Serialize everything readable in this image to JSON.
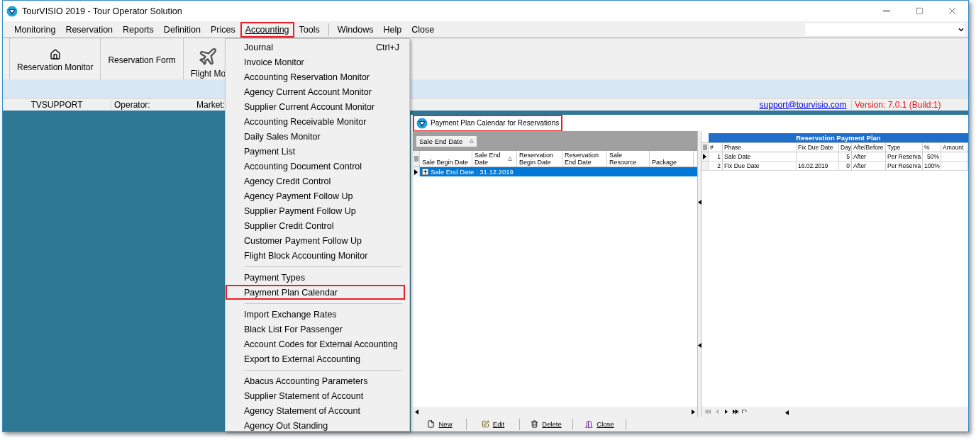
{
  "window": {
    "title": "TourVISIO 2019 - Tour Operator Solution"
  },
  "menubar": [
    {
      "label": "Monitoring",
      "selected": false
    },
    {
      "label": "Reservation",
      "selected": false
    },
    {
      "label": "Reports",
      "selected": false
    },
    {
      "label": "Definition",
      "selected": false
    },
    {
      "label": "Prices",
      "selected": false
    },
    {
      "label": "Accounting",
      "selected": true
    },
    {
      "label": "Tools",
      "selected": false
    },
    {
      "label": "Windows",
      "selected": false
    },
    {
      "label": "Help",
      "selected": false
    },
    {
      "label": "Close",
      "selected": false
    }
  ],
  "toolbar": [
    {
      "label": "Reservation Monitor"
    },
    {
      "label": "Reservation Form"
    },
    {
      "label": "Flight Mo"
    }
  ],
  "status_bar": {
    "user": "TVSUPPORT",
    "operator": "Operator:",
    "market": "Market:",
    "email": "support@tourvisio.com",
    "version": "Version: 7.0.1 (Build:1)"
  },
  "accounting_menu": [
    {
      "kind": "item",
      "label": "Journal",
      "shortcut": "Ctrl+J",
      "highlighted": false
    },
    {
      "kind": "item",
      "label": "Invoice Monitor",
      "highlighted": false
    },
    {
      "kind": "item",
      "label": "Accounting Reservation Monitor",
      "highlighted": false
    },
    {
      "kind": "item",
      "label": "Agency Current Account Monitor",
      "highlighted": false
    },
    {
      "kind": "item",
      "label": "Supplier Current Account Monitor",
      "highlighted": false
    },
    {
      "kind": "item",
      "label": "Accounting Receivable Monitor",
      "highlighted": false
    },
    {
      "kind": "item",
      "label": "Daily Sales Monitor",
      "highlighted": false
    },
    {
      "kind": "item",
      "label": "Payment List",
      "highlighted": false
    },
    {
      "kind": "item",
      "label": "Accounting Document Control",
      "highlighted": false
    },
    {
      "kind": "item",
      "label": "Agency Credit Control",
      "highlighted": false
    },
    {
      "kind": "item",
      "label": "Agency Payment Follow Up",
      "highlighted": false
    },
    {
      "kind": "item",
      "label": "Supplier Payment Follow Up",
      "highlighted": false
    },
    {
      "kind": "item",
      "label": "Supplier Credit Control",
      "highlighted": false
    },
    {
      "kind": "item",
      "label": "Customer Payment Follow Up",
      "highlighted": false
    },
    {
      "kind": "item",
      "label": "Flight Block Accounting Monitor",
      "highlighted": false
    },
    {
      "kind": "separator"
    },
    {
      "kind": "item",
      "label": "Payment Types",
      "highlighted": false
    },
    {
      "kind": "item",
      "label": "Payment Plan Calendar",
      "highlighted": true
    },
    {
      "kind": "separator"
    },
    {
      "kind": "item",
      "label": "Import Exchange Rates",
      "highlighted": false
    },
    {
      "kind": "item",
      "label": "Black List For Passenger",
      "highlighted": false
    },
    {
      "kind": "item",
      "label": "Account Codes for External Accounting",
      "highlighted": false
    },
    {
      "kind": "item",
      "label": "Export to External Accounting",
      "highlighted": false
    },
    {
      "kind": "separator"
    },
    {
      "kind": "item",
      "label": "Abacus Accounting Parameters",
      "highlighted": false
    },
    {
      "kind": "item",
      "label": "Supplier Statement of Account",
      "highlighted": false
    },
    {
      "kind": "item",
      "label": "Agency Statement of Account",
      "highlighted": false
    },
    {
      "kind": "item",
      "label": "Agency Out Standing",
      "highlighted": false
    }
  ],
  "child_window": {
    "title": "Payment Plan Calendar for Reservations",
    "highlighted": true,
    "group_by": "Sale End Date",
    "left_table": {
      "columns": [
        "Sale Begin Date",
        "Sale End Date",
        "Reservation Begin Date",
        "Reservation End Date",
        "Sale Resource",
        "Package"
      ],
      "groups": [
        {
          "label": "Sale End Date : 31.12.2019",
          "selected": true,
          "expanded": false
        }
      ]
    },
    "right_table": {
      "band": "Reservation Payment Plan",
      "columns": [
        "#",
        "Phase",
        "Fix Due Date",
        "Day",
        "Afte/Before",
        "Type",
        "%",
        "Amount"
      ],
      "rows": [
        {
          "selected": true,
          "cells": [
            "1",
            "Sale Date",
            "",
            "5",
            "After",
            "Per Reserva",
            "50%",
            ""
          ]
        },
        {
          "selected": false,
          "cells": [
            "2",
            "Fix Due Date",
            "16.02.2019",
            "0",
            "After",
            "Per Reserva",
            "100%",
            ""
          ]
        }
      ]
    },
    "buttons": [
      {
        "label": "New"
      },
      {
        "label": "Edit"
      },
      {
        "label": "Delete"
      },
      {
        "label": "Close"
      }
    ]
  }
}
